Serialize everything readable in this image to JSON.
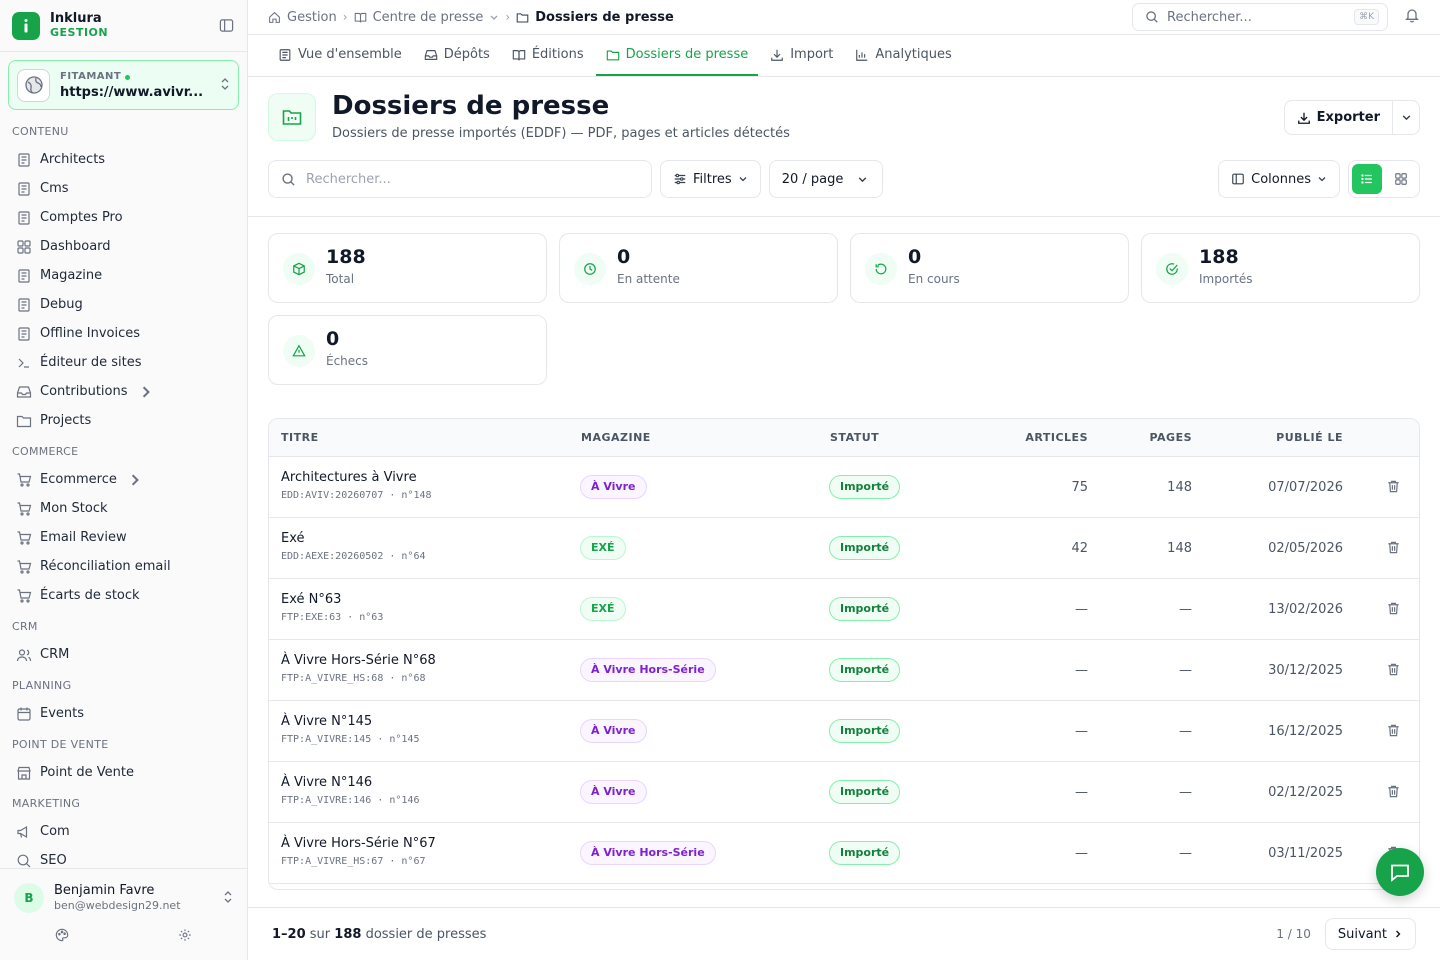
{
  "brand": {
    "name": "Inklura",
    "sub": "GESTION"
  },
  "site": {
    "label": "FITAMANT",
    "url": "https://www.avivr..."
  },
  "sidebar": {
    "sections": [
      {
        "title": "CONTENU",
        "items": [
          "Architects",
          "Cms",
          "Comptes Pro",
          "Dashboard",
          "Magazine",
          "Debug",
          "Offline Invoices",
          "Éditeur de sites",
          "Contributions",
          "Projects"
        ]
      },
      {
        "title": "COMMERCE",
        "items": [
          "Ecommerce",
          "Mon Stock",
          "Email Review",
          "Réconciliation email",
          "Écarts de stock"
        ]
      },
      {
        "title": "CRM",
        "items": [
          "CRM"
        ]
      },
      {
        "title": "PLANNING",
        "items": [
          "Events"
        ]
      },
      {
        "title": "POINT DE VENTE",
        "items": [
          "Point de Vente"
        ]
      },
      {
        "title": "MARKETING",
        "items": [
          "Com",
          "SEO"
        ]
      }
    ]
  },
  "user": {
    "initial": "B",
    "name": "Benjamin Favre",
    "email": "ben@webdesign29.net"
  },
  "breadcrumb": {
    "c1": "Gestion",
    "c2": "Centre de presse",
    "c3": "Dossiers de presse"
  },
  "search": {
    "placeholder": "Rechercher...",
    "shortcut": "⌘K"
  },
  "tabs": {
    "t1": "Vue d'ensemble",
    "t2": "Dépôts",
    "t3": "Éditions",
    "t4": "Dossiers de presse",
    "t5": "Import",
    "t6": "Analytiques"
  },
  "page": {
    "title": "Dossiers de presse",
    "subtitle": "Dossiers de presse importés (EDDF) — PDF, pages et articles détectés",
    "export_label": "Exporter"
  },
  "controls": {
    "search_placeholder": "Rechercher...",
    "filters": "Filtres",
    "per_page": "20 / page",
    "columns": "Colonnes"
  },
  "stats": {
    "total": {
      "value": "188",
      "label": "Total"
    },
    "pending": {
      "value": "0",
      "label": "En attente"
    },
    "running": {
      "value": "0",
      "label": "En cours"
    },
    "imported": {
      "value": "188",
      "label": "Importés"
    },
    "failed": {
      "value": "0",
      "label": "Échecs"
    }
  },
  "table": {
    "headers": {
      "title": "TITRE",
      "magazine": "MAGAZINE",
      "status": "STATUT",
      "articles": "ARTICLES",
      "pages": "PAGES",
      "published": "PUBLIÉ LE"
    },
    "rows": [
      {
        "title": "Architectures à Vivre",
        "code": "EDD:AVIV:20260707 · n°148",
        "magazine": "À Vivre",
        "mag_color": "purple",
        "status": "Importé",
        "articles": "75",
        "pages": "148",
        "date": "07/07/2026"
      },
      {
        "title": "Exé",
        "code": "EDD:AEXE:20260502 · n°64",
        "magazine": "EXÉ",
        "mag_color": "green",
        "status": "Importé",
        "articles": "42",
        "pages": "148",
        "date": "02/05/2026"
      },
      {
        "title": "Exé N°63",
        "code": "FTP:EXE:63 · n°63",
        "magazine": "EXÉ",
        "mag_color": "green",
        "status": "Importé",
        "articles": "—",
        "pages": "—",
        "date": "13/02/2026"
      },
      {
        "title": "À Vivre Hors-Série N°68",
        "code": "FTP:A_VIVRE_HS:68 · n°68",
        "magazine": "À Vivre Hors-Série",
        "mag_color": "purple",
        "status": "Importé",
        "articles": "—",
        "pages": "—",
        "date": "30/12/2025"
      },
      {
        "title": "À Vivre N°145",
        "code": "FTP:A_VIVRE:145 · n°145",
        "magazine": "À Vivre",
        "mag_color": "purple",
        "status": "Importé",
        "articles": "—",
        "pages": "—",
        "date": "16/12/2025"
      },
      {
        "title": "À Vivre N°146",
        "code": "FTP:A_VIVRE:146 · n°146",
        "magazine": "À Vivre",
        "mag_color": "purple",
        "status": "Importé",
        "articles": "—",
        "pages": "—",
        "date": "02/12/2025"
      },
      {
        "title": "À Vivre Hors-Série N°67",
        "code": "FTP:A_VIVRE_HS:67 · n°67",
        "magazine": "À Vivre Hors-Série",
        "mag_color": "purple",
        "status": "Importé",
        "articles": "—",
        "pages": "—",
        "date": "03/11/2025"
      }
    ]
  },
  "footer": {
    "range": "1–20",
    "sur": "sur",
    "total": "188",
    "unit": "dossier de presses",
    "page_count": "1 / 10",
    "next": "Suivant"
  },
  "colors": {
    "accent": "#16a34a",
    "magazine_purple": "#7e22ce",
    "status_green": "#15803d"
  }
}
